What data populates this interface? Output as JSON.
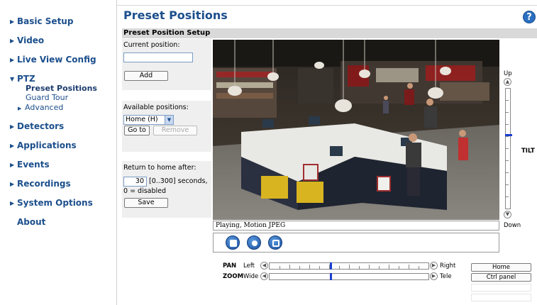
{
  "sidebar": {
    "items": [
      {
        "label": "Basic Setup"
      },
      {
        "label": "Video"
      },
      {
        "label": "Live View Config"
      },
      {
        "label": "PTZ"
      },
      {
        "label": "Detectors"
      },
      {
        "label": "Applications"
      },
      {
        "label": "Events"
      },
      {
        "label": "Recordings"
      },
      {
        "label": "System Options"
      },
      {
        "label": "About"
      }
    ],
    "ptz_sub": {
      "preset_positions": "Preset Positions",
      "guard_tour": "Guard Tour",
      "advanced": "Advanced"
    }
  },
  "page": {
    "title": "Preset Positions",
    "section": "Preset Position Setup",
    "help_glyph": "?"
  },
  "form": {
    "current_position_label": "Current position:",
    "current_position_value": "",
    "add_label": "Add",
    "available_positions_label": "Available positions:",
    "available_selected": "Home (H)",
    "goto_label": "Go to",
    "remove_label": "Remove",
    "return_home_label": "Return to home after:",
    "return_home_value": "30",
    "return_home_hint": "[0..300] seconds,",
    "return_home_hint2": "0 = disabled",
    "save_label": "Save"
  },
  "video": {
    "status": "Playing, Motion JPEG"
  },
  "tilt": {
    "up_label": "Up",
    "down_label": "Down",
    "label": "TILT",
    "level": 0.38
  },
  "pan": {
    "label": "PAN",
    "left": "Left",
    "right": "Right",
    "level": 0.38
  },
  "zoom": {
    "label": "ZOOM",
    "wide": "Wide",
    "tele": "Tele",
    "level": 0.38
  },
  "side_buttons": {
    "home": "Home",
    "ctrl_panel": "Ctrl panel"
  },
  "colors": {
    "link": "#1c4f8c",
    "slider_thumb": "#1a3fd0",
    "section_bar": "#d9d9d9"
  }
}
